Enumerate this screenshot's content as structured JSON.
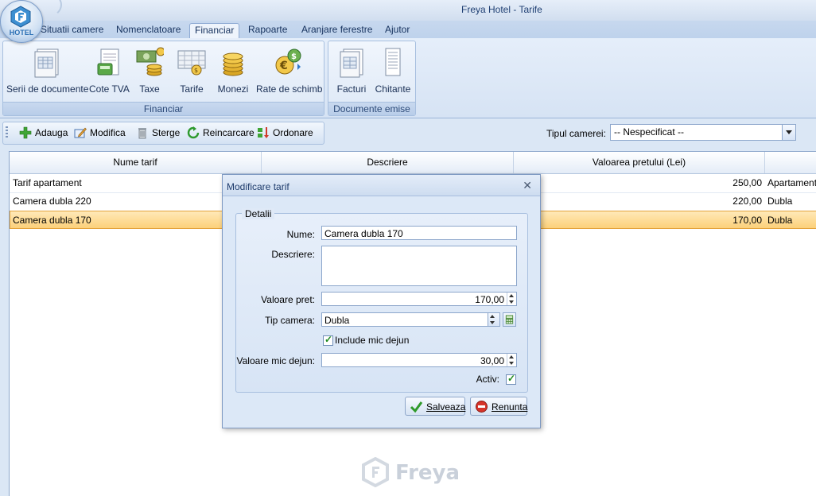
{
  "window": {
    "title": "Freya Hotel - Tarife",
    "logo_text": "HOTEL"
  },
  "tabs": [
    {
      "label": "Situatii camere"
    },
    {
      "label": "Nomenclatoare"
    },
    {
      "label": "Financiar",
      "active": true
    },
    {
      "label": "Rapoarte"
    },
    {
      "label": "Aranjare ferestre"
    },
    {
      "label": "Ajutor"
    }
  ],
  "ribbon": {
    "groups": [
      {
        "label": "Financiar",
        "buttons": [
          {
            "label": "Serii de documente",
            "icon": "document-series-icon"
          },
          {
            "label": "Cote TVA",
            "icon": "vat-icon"
          },
          {
            "label": "Taxe",
            "icon": "taxes-icon"
          },
          {
            "label": "Tarife",
            "icon": "rates-icon"
          },
          {
            "label": "Monezi",
            "icon": "coins-icon"
          },
          {
            "label": "Rate de schimb",
            "icon": "exchange-rate-icon"
          }
        ]
      },
      {
        "label": "Documente emise",
        "buttons": [
          {
            "label": "Facturi",
            "icon": "invoice-icon"
          },
          {
            "label": "Chitante",
            "icon": "receipt-icon"
          }
        ]
      }
    ]
  },
  "toolbar": {
    "add": "Adauga",
    "edit": "Modifica",
    "delete": "Sterge",
    "reload": "Reincarcare",
    "order": "Ordonare"
  },
  "filter": {
    "label": "Tipul camerei:",
    "value": "-- Nespecificat --"
  },
  "grid": {
    "columns": [
      "Nume tarif",
      "Descriere",
      "Valoarea pretului (Lei)",
      ""
    ],
    "rows": [
      {
        "name": "Tarif apartament",
        "description": "",
        "price": "250,00",
        "type": "Apartament"
      },
      {
        "name": "Camera dubla 220",
        "description": "",
        "price": "220,00",
        "type": "Dubla"
      },
      {
        "name": "Camera dubla 170",
        "description": "",
        "price": "170,00",
        "type": "Dubla",
        "selected": true
      }
    ]
  },
  "watermark": "Freya",
  "dialog": {
    "title": "Modificare tarif",
    "group_label": "Detalii",
    "fields": {
      "name_label": "Nume:",
      "name_value": "Camera dubla 170",
      "description_label": "Descriere:",
      "description_value": "",
      "price_label": "Valoare pret:",
      "price_value": "170,00",
      "room_type_label": "Tip camera:",
      "room_type_value": "Dubla",
      "include_breakfast_label": "Include mic dejun",
      "include_breakfast_checked": true,
      "breakfast_value_label": "Valoare mic dejun:",
      "breakfast_value": "30,00",
      "active_label": "Activ:",
      "active_checked": true
    },
    "save_label": "Salveaza",
    "cancel_label": "Renunta"
  }
}
